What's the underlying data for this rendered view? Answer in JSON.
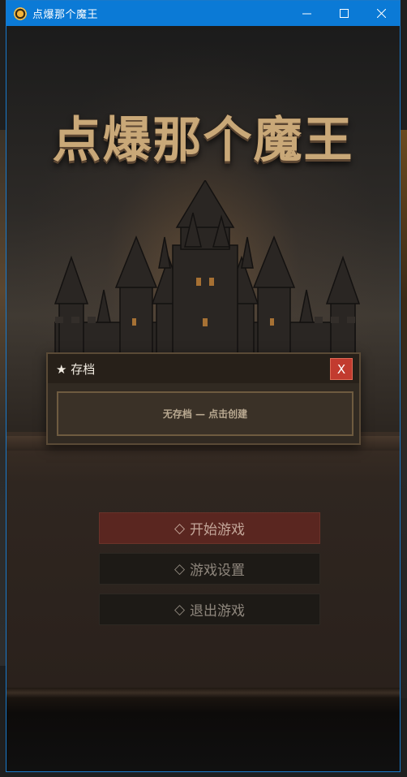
{
  "window": {
    "title": "点爆那个魔王",
    "controls": {
      "minimize": "—",
      "close": "✕"
    }
  },
  "game": {
    "logo": "点爆那个魔王"
  },
  "save_dialog": {
    "title": "★ 存档",
    "close_label": "X",
    "slot_text": "无存档 — 点击创建"
  },
  "menu": {
    "items": [
      {
        "label": "开始游戏",
        "icon": "◇"
      },
      {
        "label": "游戏设置",
        "icon": "◇"
      },
      {
        "label": "退出游戏",
        "icon": "◇"
      }
    ]
  },
  "colors": {
    "titlebar": "#0b7ad6",
    "primary_button": "#5a2620",
    "close_button": "#c23b2f",
    "logo": "#c9a878"
  }
}
